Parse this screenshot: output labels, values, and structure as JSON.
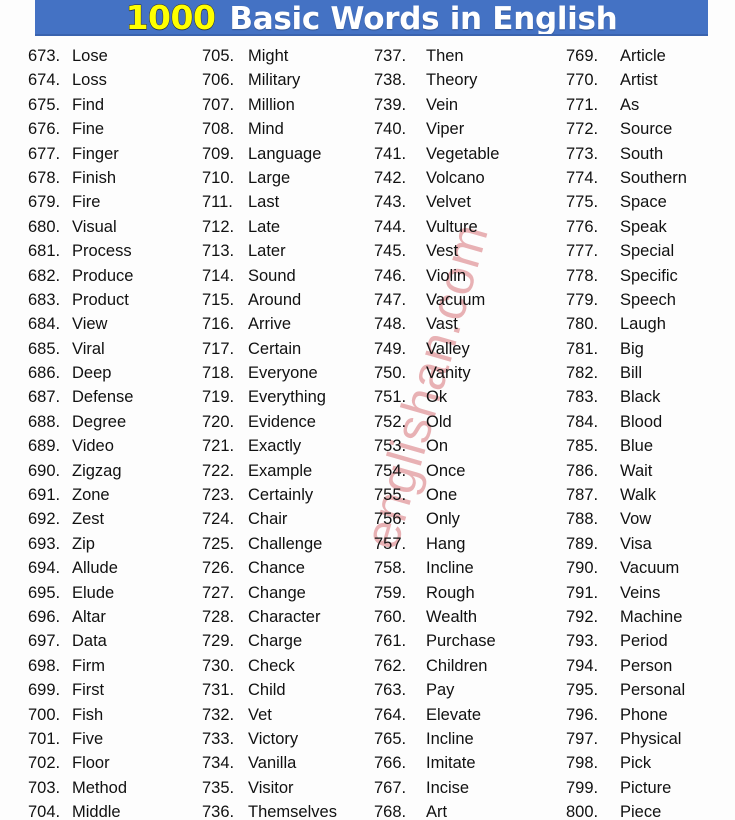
{
  "header": {
    "number": "1000",
    "title": "Basic Words in English",
    "banner_color": "#4472C4",
    "number_color": "#FFFF00",
    "title_color": "#FFFFFF"
  },
  "watermark": {
    "text": "englishan.com",
    "color": "#E8B1B4"
  },
  "columns": [
    {
      "items": [
        {
          "number": "673.",
          "word": "Lose"
        },
        {
          "number": "674.",
          "word": "Loss"
        },
        {
          "number": "675.",
          "word": "Find"
        },
        {
          "number": "676.",
          "word": "Fine"
        },
        {
          "number": "677.",
          "word": "Finger"
        },
        {
          "number": "678.",
          "word": "Finish"
        },
        {
          "number": "679.",
          "word": "Fire"
        },
        {
          "number": "680.",
          "word": "Visual"
        },
        {
          "number": "681.",
          "word": "Process"
        },
        {
          "number": "682.",
          "word": "Produce"
        },
        {
          "number": "683.",
          "word": "Product"
        },
        {
          "number": "684.",
          "word": "View"
        },
        {
          "number": "685.",
          "word": "Viral"
        },
        {
          "number": "686.",
          "word": "Deep"
        },
        {
          "number": "687.",
          "word": "Defense"
        },
        {
          "number": "688.",
          "word": "Degree"
        },
        {
          "number": "689.",
          "word": "Video"
        },
        {
          "number": "690.",
          "word": "Zigzag"
        },
        {
          "number": "691.",
          "word": "Zone"
        },
        {
          "number": "692.",
          "word": "Zest"
        },
        {
          "number": "693.",
          "word": "Zip"
        },
        {
          "number": "694.",
          "word": "Allude"
        },
        {
          "number": "695.",
          "word": "Elude"
        },
        {
          "number": "696.",
          "word": "Altar"
        },
        {
          "number": "697.",
          "word": "Data"
        },
        {
          "number": "698.",
          "word": "Firm"
        },
        {
          "number": "699.",
          "word": "First"
        },
        {
          "number": "700.",
          "word": "Fish"
        },
        {
          "number": "701.",
          "word": "Five"
        },
        {
          "number": "702.",
          "word": "Floor"
        },
        {
          "number": "703.",
          "word": "Method"
        },
        {
          "number": "704.",
          "word": "Middle"
        }
      ]
    },
    {
      "items": [
        {
          "number": "705.",
          "word": "Might"
        },
        {
          "number": "706.",
          "word": "Military"
        },
        {
          "number": "707.",
          "word": "Million"
        },
        {
          "number": "708.",
          "word": "Mind"
        },
        {
          "number": "709.",
          "word": "Language"
        },
        {
          "number": "710.",
          "word": "Large"
        },
        {
          "number": "711.",
          "word": "Last"
        },
        {
          "number": "712.",
          "word": "Late"
        },
        {
          "number": "713.",
          "word": "Later"
        },
        {
          "number": "714.",
          "word": "Sound"
        },
        {
          "number": "715.",
          "word": "Around"
        },
        {
          "number": "716.",
          "word": "Arrive"
        },
        {
          "number": "717.",
          "word": "Certain"
        },
        {
          "number": "718.",
          "word": "Everyone"
        },
        {
          "number": "719.",
          "word": "Everything"
        },
        {
          "number": "720.",
          "word": "Evidence"
        },
        {
          "number": "721.",
          "word": "Exactly"
        },
        {
          "number": "722.",
          "word": "Example"
        },
        {
          "number": "723.",
          "word": "Certainly"
        },
        {
          "number": "724.",
          "word": "Chair"
        },
        {
          "number": "725.",
          "word": "Challenge"
        },
        {
          "number": "726.",
          "word": "Chance"
        },
        {
          "number": "727.",
          "word": "Change"
        },
        {
          "number": "728.",
          "word": "Character"
        },
        {
          "number": "729.",
          "word": "Charge"
        },
        {
          "number": "730.",
          "word": "Check"
        },
        {
          "number": "731.",
          "word": "Child"
        },
        {
          "number": "732.",
          "word": "Vet"
        },
        {
          "number": "733.",
          "word": "Victory"
        },
        {
          "number": "734.",
          "word": "Vanilla"
        },
        {
          "number": "735.",
          "word": "Visitor"
        },
        {
          "number": "736.",
          "word": "Themselves"
        }
      ]
    },
    {
      "items": [
        {
          "number": "737.",
          "word": "Then"
        },
        {
          "number": "738.",
          "word": "Theory"
        },
        {
          "number": "739.",
          "word": "Vein"
        },
        {
          "number": "740.",
          "word": "Viper"
        },
        {
          "number": "741.",
          "word": "Vegetable"
        },
        {
          "number": "742.",
          "word": "Volcano"
        },
        {
          "number": "743.",
          "word": "Velvet"
        },
        {
          "number": "744.",
          "word": "Vulture"
        },
        {
          "number": "745.",
          "word": "Vest"
        },
        {
          "number": "746.",
          "word": "Violin"
        },
        {
          "number": "747.",
          "word": "Vacuum"
        },
        {
          "number": "748.",
          "word": "Vast"
        },
        {
          "number": "749.",
          "word": "Valley"
        },
        {
          "number": "750.",
          "word": "Vanity"
        },
        {
          "number": "751.",
          "word": "Ok"
        },
        {
          "number": "752.",
          "word": "Old"
        },
        {
          "number": "753.",
          "word": "On"
        },
        {
          "number": "754.",
          "word": "Once"
        },
        {
          "number": "755.",
          "word": "One"
        },
        {
          "number": "756.",
          "word": "Only"
        },
        {
          "number": "757.",
          "word": "Hang"
        },
        {
          "number": "758.",
          "word": "Incline"
        },
        {
          "number": "759.",
          "word": "Rough"
        },
        {
          "number": "760.",
          "word": "Wealth"
        },
        {
          "number": "761.",
          "word": "Purchase"
        },
        {
          "number": "762.",
          "word": "Children"
        },
        {
          "number": "763.",
          "word": "Pay"
        },
        {
          "number": "764.",
          "word": "Elevate"
        },
        {
          "number": "765.",
          "word": "Incline"
        },
        {
          "number": "766.",
          "word": "Imitate"
        },
        {
          "number": "767.",
          "word": "Incise"
        },
        {
          "number": "768.",
          "word": "Art"
        }
      ]
    },
    {
      "items": [
        {
          "number": "769.",
          "word": "Article"
        },
        {
          "number": "770.",
          "word": "Artist"
        },
        {
          "number": "771.",
          "word": "As"
        },
        {
          "number": "772.",
          "word": "Source"
        },
        {
          "number": "773.",
          "word": "South"
        },
        {
          "number": "774.",
          "word": "Southern"
        },
        {
          "number": "775.",
          "word": "Space"
        },
        {
          "number": "776.",
          "word": "Speak"
        },
        {
          "number": "777.",
          "word": "Special"
        },
        {
          "number": "778.",
          "word": "Specific"
        },
        {
          "number": "779.",
          "word": "Speech"
        },
        {
          "number": "780.",
          "word": "Laugh"
        },
        {
          "number": "781.",
          "word": "Big"
        },
        {
          "number": "782.",
          "word": "Bill"
        },
        {
          "number": "783.",
          "word": "Black"
        },
        {
          "number": "784.",
          "word": "Blood"
        },
        {
          "number": "785.",
          "word": "Blue"
        },
        {
          "number": "786.",
          "word": "Wait"
        },
        {
          "number": "787.",
          "word": "Walk"
        },
        {
          "number": "788.",
          "word": "Vow"
        },
        {
          "number": "789.",
          "word": "Visa"
        },
        {
          "number": "790.",
          "word": "Vacuum"
        },
        {
          "number": "791.",
          "word": "Veins"
        },
        {
          "number": "792.",
          "word": "Machine"
        },
        {
          "number": "793.",
          "word": "Period"
        },
        {
          "number": "794.",
          "word": "Person"
        },
        {
          "number": "795.",
          "word": "Personal"
        },
        {
          "number": "796.",
          "word": "Phone"
        },
        {
          "number": "797.",
          "word": "Physical"
        },
        {
          "number": "798.",
          "word": "Pick"
        },
        {
          "number": "799.",
          "word": "Picture"
        },
        {
          "number": "800.",
          "word": "Piece"
        }
      ]
    }
  ]
}
